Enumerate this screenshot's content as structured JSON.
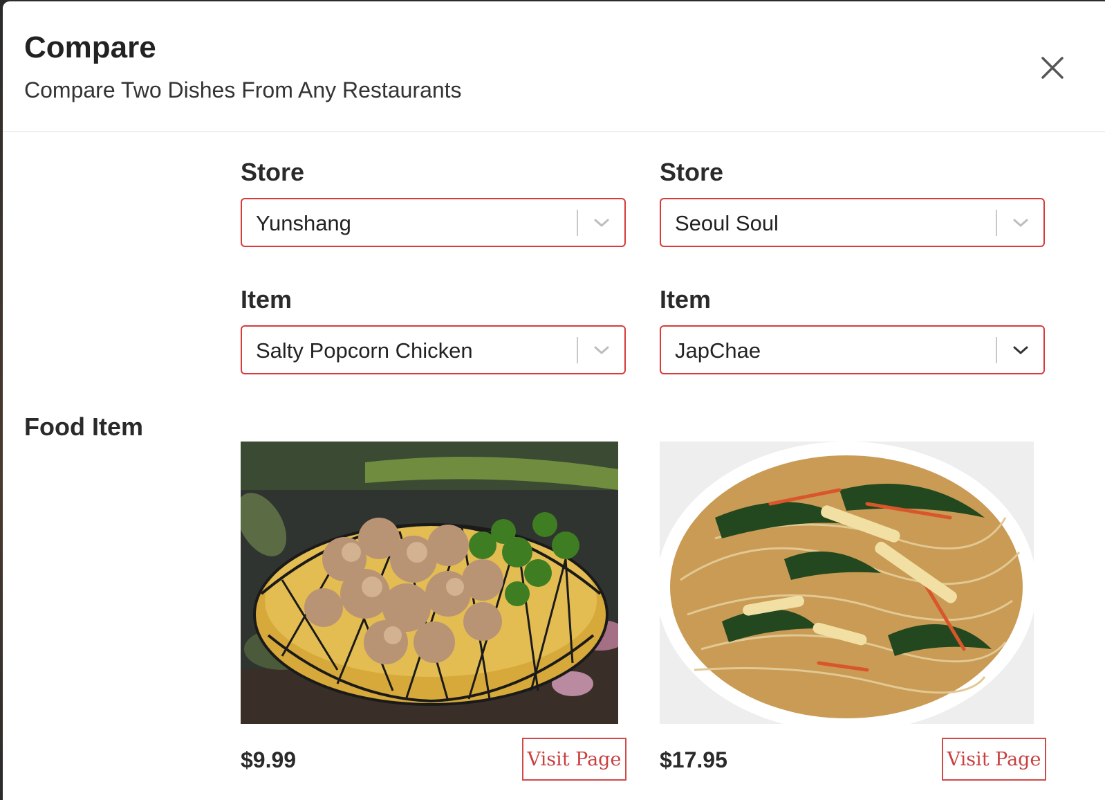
{
  "modal": {
    "title": "Compare",
    "subtitle": "Compare Two Dishes From Any Restaurants",
    "close_icon": "close-icon"
  },
  "left": {
    "store_label": "Store",
    "store_value": "Yunshang",
    "item_label": "Item",
    "item_value": "Salty Popcorn Chicken",
    "price": "$9.99",
    "visit_label": "Visit Page",
    "image_subject": "salty popcorn chicken in woven basket"
  },
  "right": {
    "store_label": "Store",
    "store_value": "Seoul Soul",
    "item_label": "Item",
    "item_value": "JapChae",
    "price": "$17.95",
    "visit_label": "Visit Page",
    "image_subject": "japchae glass noodles on white plate"
  },
  "section": {
    "food_item_label": "Food Item"
  },
  "colors": {
    "accent_border": "#d93a3a",
    "visit_text": "#c94040"
  }
}
